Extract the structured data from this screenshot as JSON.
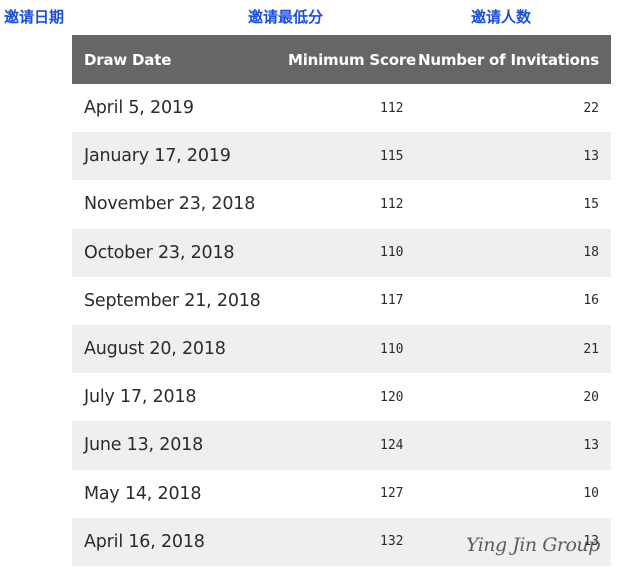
{
  "labels_cn": {
    "date": "邀请日期",
    "score": "邀请最低分",
    "count": "邀请人数"
  },
  "colors": {
    "label_blue": "#1a4fe0",
    "header_bg": "#666666",
    "row_alt_bg": "#efefef"
  },
  "table": {
    "headers": {
      "date": "Draw Date",
      "score": "Minimum Score",
      "count": "Number of Invitations"
    },
    "rows": [
      {
        "date": "April 5, 2019",
        "score": "112",
        "count": "22"
      },
      {
        "date": "January 17, 2019",
        "score": "115",
        "count": "13"
      },
      {
        "date": "November 23, 2018",
        "score": "112",
        "count": "15"
      },
      {
        "date": "October 23, 2018",
        "score": "110",
        "count": "18"
      },
      {
        "date": "September 21, 2018",
        "score": "117",
        "count": "16"
      },
      {
        "date": "August 20, 2018",
        "score": "110",
        "count": "21"
      },
      {
        "date": "July 17, 2018",
        "score": "120",
        "count": "20"
      },
      {
        "date": "June 13, 2018",
        "score": "124",
        "count": "13"
      },
      {
        "date": "May 14, 2018",
        "score": "127",
        "count": "10"
      },
      {
        "date": "April 16, 2018",
        "score": "132",
        "count": "13"
      }
    ]
  },
  "watermark": "Ying Jin Group"
}
